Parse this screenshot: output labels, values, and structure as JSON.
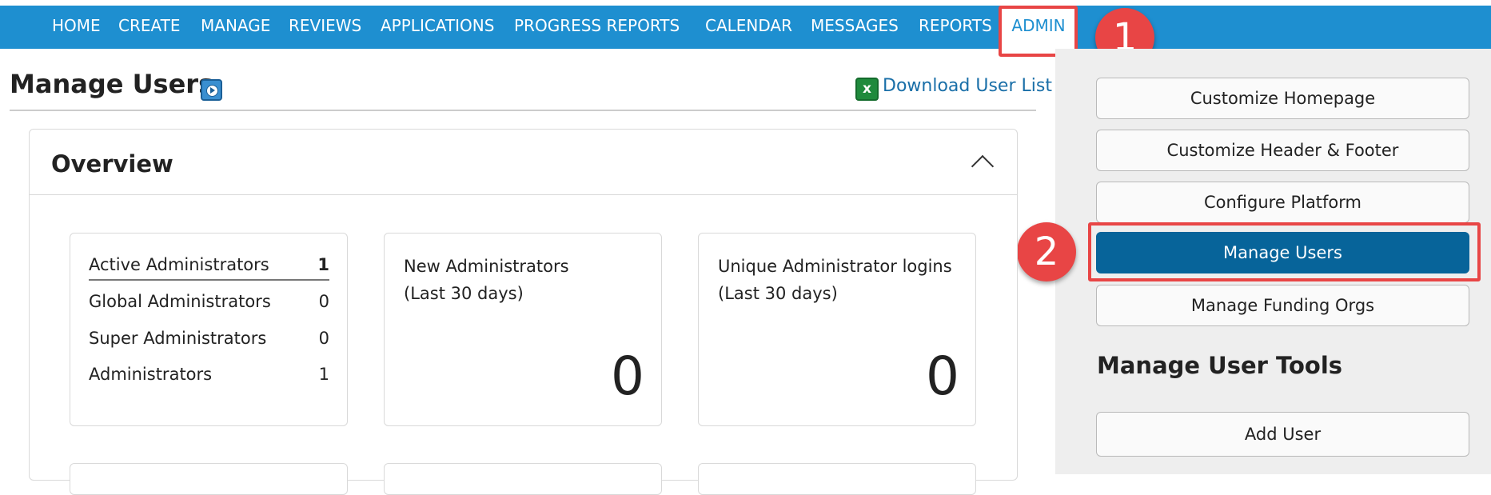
{
  "nav": {
    "items": [
      "HOME",
      "CREATE",
      "MANAGE",
      "REVIEWS",
      "APPLICATIONS",
      "PROGRESS REPORTS",
      "CALENDAR",
      "MESSAGES",
      "REPORTS"
    ],
    "active": "ADMIN"
  },
  "callouts": [
    "1",
    "2"
  ],
  "page": {
    "title": "Manage Users",
    "download_label": "Download User List",
    "excel_glyph": "x"
  },
  "overview": {
    "title": "Overview",
    "admin_counts": [
      {
        "label": "Active Administrators",
        "value": "1"
      },
      {
        "label": "Global Administrators",
        "value": "0"
      },
      {
        "label": "Super Administrators",
        "value": "0"
      },
      {
        "label": "Administrators",
        "value": "1"
      }
    ],
    "new_admins": {
      "line1": "New Administrators",
      "line2": "(Last 30 days)",
      "value": "0"
    },
    "unique_logins": {
      "line1": "Unique Administrator logins",
      "line2": "(Last 30 days)",
      "value": "0"
    }
  },
  "sidebar": {
    "buttons": [
      "Customize Homepage",
      "Customize Header & Footer",
      "Configure Platform",
      "Manage Users",
      "Manage Funding Orgs"
    ],
    "active": "Manage Users",
    "tools_heading": "Manage User Tools",
    "tools_buttons": [
      "Add User"
    ]
  },
  "colors": {
    "nav_bg": "#1e8fd0",
    "active_button": "#07649a",
    "highlight": "#e84545"
  }
}
